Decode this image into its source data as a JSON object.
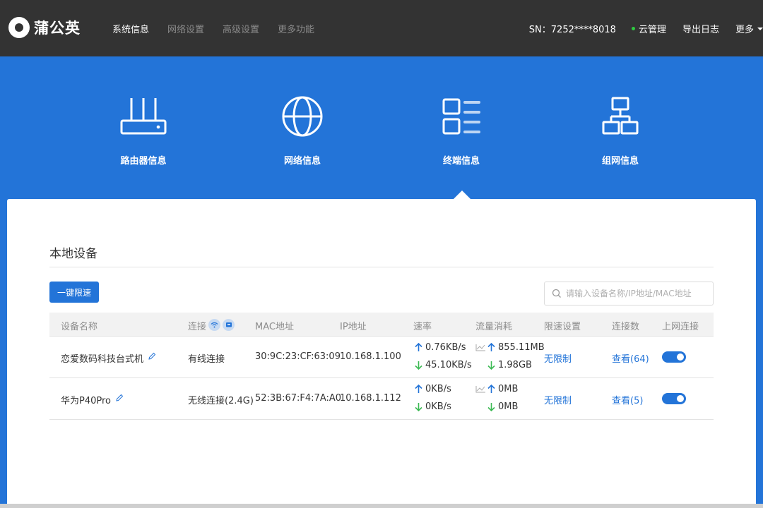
{
  "header": {
    "brand": "蒲公英",
    "nav": [
      "系统信息",
      "网络设置",
      "高级设置",
      "更多功能"
    ],
    "sn": "SN：7252****8018",
    "cloud": "云管理",
    "export": "导出日志",
    "more": "更多"
  },
  "features": [
    "路由器信息",
    "网络信息",
    "终端信息",
    "组网信息"
  ],
  "section": {
    "title": "本地设备",
    "limit_button": "一键限速",
    "search_placeholder": "请输入设备名称/IP地址/MAC地址"
  },
  "table": {
    "columns": [
      "设备名称",
      "连接",
      "MAC地址",
      "IP地址",
      "速率",
      "流量消耗",
      "限速设置",
      "连接数",
      "上网连接"
    ],
    "rows": [
      {
        "name": "恋爱数码科技台式机",
        "connection": "有线连接",
        "mac": "30:9C:23:CF:63:09",
        "ip": "10.168.1.100",
        "rate_up": "0.76KB/s",
        "rate_down": "45.10KB/s",
        "traffic_up": "855.11MB",
        "traffic_down": "1.98GB",
        "limit": "无限制",
        "connections": "查看(64)",
        "online": true
      },
      {
        "name": "华为P40Pro",
        "connection": "无线连接(2.4G)",
        "mac": "52:3B:67:F4:7A:A0",
        "ip": "10.168.1.112",
        "rate_up": "0KB/s",
        "rate_down": "0KB/s",
        "traffic_up": "0MB",
        "traffic_down": "0MB",
        "limit": "无限制",
        "connections": "查看(5)",
        "online": true
      }
    ]
  },
  "colors": {
    "brand_blue": "#2374d8",
    "topbar": "#333333",
    "up_arrow": "#2374d8",
    "down_arrow": "#3cba54",
    "status_dot": "#2ecc40"
  },
  "icons": {
    "logo": "dandelion-logo-icon",
    "router": "router-icon",
    "network": "globe-icon",
    "terminal": "device-list-icon",
    "group": "topology-icon",
    "search": "search-icon",
    "edit": "pencil-icon",
    "wifi": "wifi-icon",
    "wired": "ethernet-icon",
    "up": "arrow-up-icon",
    "down": "arrow-down-icon",
    "chart": "line-chart-icon"
  }
}
